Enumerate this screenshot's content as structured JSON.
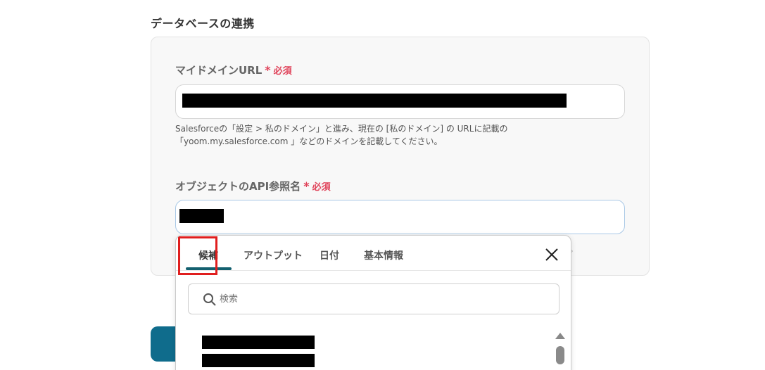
{
  "section": {
    "title": "データベースの連携"
  },
  "domain_field": {
    "label": "マイドメインURL",
    "required_mark": "*",
    "required_text": "必須",
    "help_line1": "Salesforceの「設定 > 私のドメイン」と進み、現在の [私のドメイン] の URLに記載の",
    "help_line2": "「yoom.my.salesforce.com 」などのドメインを記載してください。"
  },
  "object_field": {
    "label": "オブジェクトのAPI参照名",
    "required_mark": "*",
    "required_text": "必須"
  },
  "dropdown": {
    "tabs": [
      {
        "label": "候補"
      },
      {
        "label": "アウトプット"
      },
      {
        "label": "日付"
      },
      {
        "label": "基本情報"
      }
    ],
    "search_placeholder": "検索"
  },
  "trailing_mark": "。",
  "colors": {
    "required": "#e0435a",
    "accent": "#13606f",
    "button": "#0f6c8c",
    "highlight": "#e01e1e"
  }
}
